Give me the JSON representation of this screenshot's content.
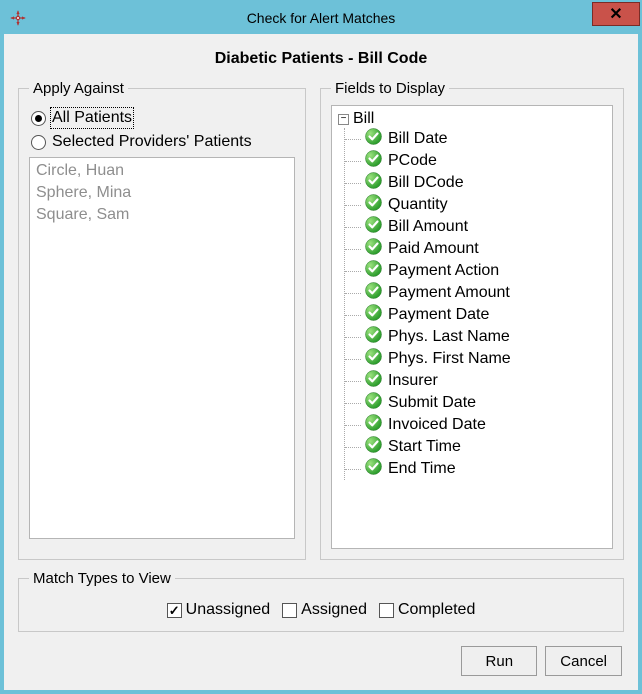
{
  "window": {
    "title": "Check for Alert Matches"
  },
  "dialog": {
    "heading": "Diabetic Patients - Bill Code"
  },
  "applyAgainst": {
    "legend": "Apply Against",
    "options": {
      "all": {
        "label": "All Patients",
        "checked": true
      },
      "selected": {
        "label": "Selected Providers' Patients",
        "checked": false
      }
    },
    "providers": [
      "Circle, Huan",
      "Sphere, Mina",
      "Square, Sam"
    ]
  },
  "fields": {
    "legend": "Fields to Display",
    "root": "Bill",
    "items": [
      "Bill Date",
      "PCode",
      "Bill DCode",
      "Quantity",
      "Bill Amount",
      "Paid Amount",
      "Payment Action",
      "Payment Amount",
      "Payment Date",
      "Phys. Last Name",
      "Phys. First Name",
      "Insurer",
      "Submit Date",
      "Invoiced Date",
      "Start Time",
      "End Time"
    ]
  },
  "matchTypes": {
    "legend": "Match Types to View",
    "options": [
      {
        "label": "Unassigned",
        "checked": true
      },
      {
        "label": "Assigned",
        "checked": false
      },
      {
        "label": "Completed",
        "checked": false
      }
    ]
  },
  "buttons": {
    "run": "Run",
    "cancel": "Cancel"
  }
}
